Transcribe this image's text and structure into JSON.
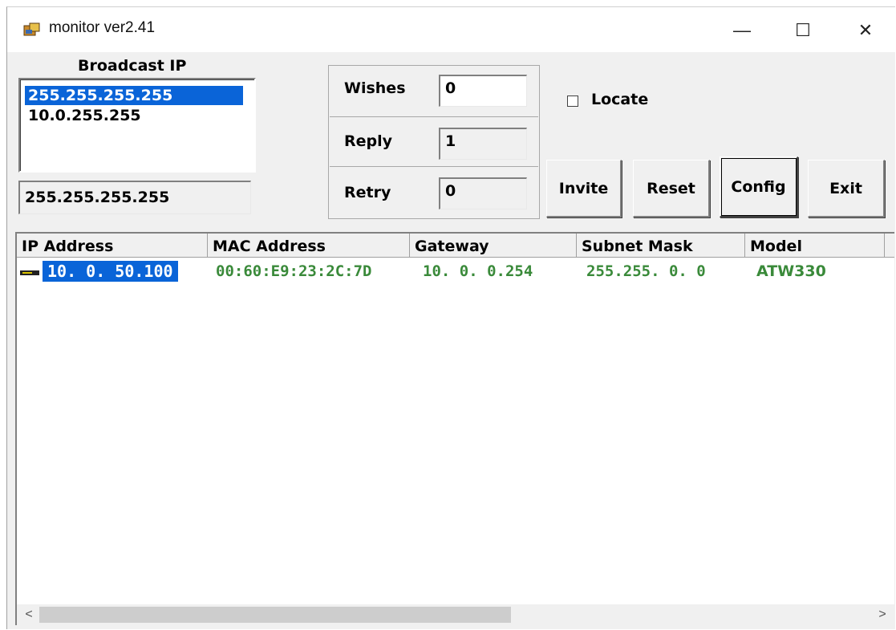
{
  "window": {
    "title": "monitor ver2.41",
    "controls": {
      "minimize": "—",
      "maximize": "☐",
      "close": "✕"
    }
  },
  "broadcast": {
    "label": "Broadcast IP",
    "items": [
      "255.255.255.255",
      "10.0.255.255"
    ],
    "selected_index": 0,
    "value": "255.255.255.255"
  },
  "counters": {
    "wishes": {
      "label": "Wishes",
      "value": "0"
    },
    "reply": {
      "label": "Reply",
      "value": "1"
    },
    "retry": {
      "label": "Retry",
      "value": "0"
    }
  },
  "locate": {
    "label": "Locate",
    "checked": false
  },
  "buttons": {
    "invite": "Invite",
    "reset": "Reset",
    "config": "Config",
    "exit": "Exit"
  },
  "table": {
    "columns": [
      "IP Address",
      "MAC Address",
      "Gateway",
      "Subnet Mask",
      "Model"
    ],
    "rows": [
      {
        "ip": "10. 0. 50.100",
        "mac": "00:60:E9:23:2C:7D",
        "gateway": "10. 0. 0.254",
        "subnet": "255.255. 0. 0",
        "model": "ATW330"
      }
    ],
    "row_text_color": "#3a8a3a",
    "selection_color": "#0a64d8"
  },
  "scrollbar": {
    "left_arrow": "<",
    "right_arrow": ">"
  }
}
